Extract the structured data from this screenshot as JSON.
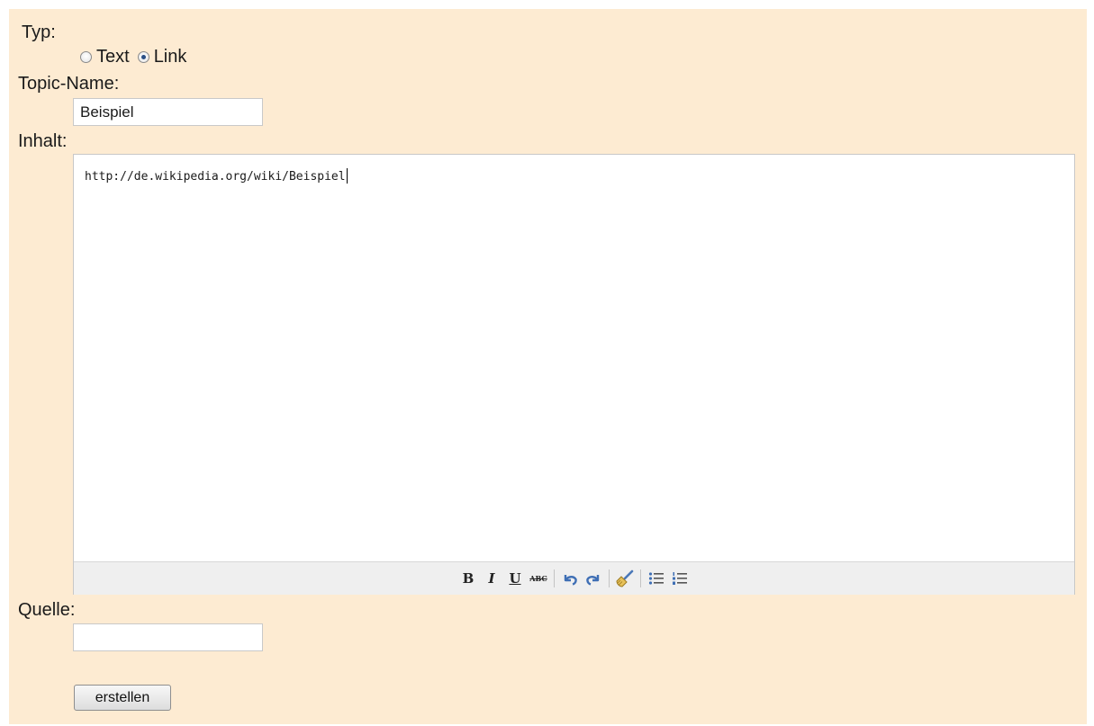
{
  "form": {
    "typ_label": "Typ:",
    "typ_options": [
      {
        "label": "Text",
        "checked": false
      },
      {
        "label": "Link",
        "checked": true
      }
    ],
    "topic_label": "Topic-Name:",
    "topic_value": "Beispiel",
    "inhalt_label": "Inhalt:",
    "inhalt_value": "http://de.wikipedia.org/wiki/Beispiel",
    "quelle_label": "Quelle:",
    "quelle_value": "",
    "submit_label": "erstellen"
  },
  "toolbar": {
    "bold": "B",
    "italic": "I",
    "underline": "U",
    "strikethrough": "ABC",
    "icons": [
      "bold-icon",
      "italic-icon",
      "underline-icon",
      "strikethrough-icon",
      "undo-icon",
      "redo-icon",
      "clean-format-icon",
      "bullet-list-icon",
      "numbered-list-icon"
    ]
  },
  "colors": {
    "panel_background": "#fdebd2",
    "icon_blue": "#3f6fb5"
  }
}
